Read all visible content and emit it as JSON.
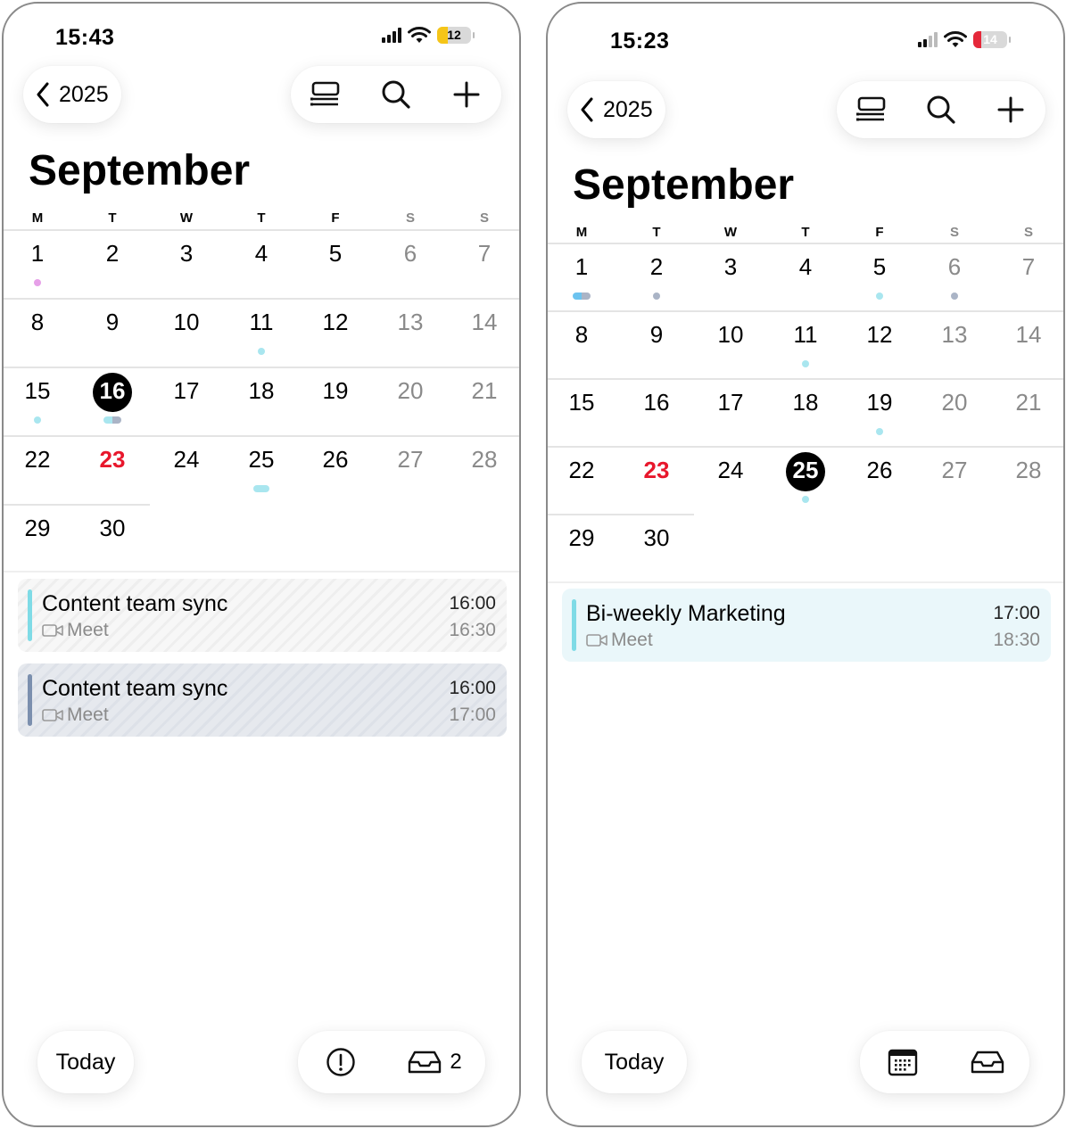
{
  "left": {
    "status": {
      "time": "15:43",
      "battery": "12",
      "battery_color": "#f5c518"
    },
    "nav": {
      "back_label": "2025"
    },
    "month_title": "September",
    "weekdays": [
      "M",
      "T",
      "W",
      "T",
      "F",
      "S",
      "S"
    ],
    "weeks": [
      [
        "1",
        "2",
        "3",
        "4",
        "5",
        "6",
        "7"
      ],
      [
        "8",
        "9",
        "10",
        "11",
        "12",
        "13",
        "14"
      ],
      [
        "15",
        "16",
        "17",
        "18",
        "19",
        "20",
        "21"
      ],
      [
        "22",
        "23",
        "24",
        "25",
        "26",
        "27",
        "28"
      ],
      [
        "29",
        "30"
      ]
    ],
    "selected_day": "16",
    "holiday_day": "23",
    "events": [
      {
        "title": "Content team sync",
        "location": "Meet",
        "start": "16:00",
        "end": "16:30",
        "color": "#7fdbe6"
      },
      {
        "title": "Content team sync",
        "location": "Meet",
        "start": "16:00",
        "end": "17:00",
        "color": "#7b8fae"
      }
    ],
    "bottom": {
      "today_label": "Today",
      "inbox_count": "2"
    }
  },
  "right": {
    "status": {
      "time": "15:23",
      "battery": "14",
      "battery_color": "#e5283a"
    },
    "nav": {
      "back_label": "2025"
    },
    "month_title": "September",
    "weekdays": [
      "M",
      "T",
      "W",
      "T",
      "F",
      "S",
      "S"
    ],
    "weeks": [
      [
        "1",
        "2",
        "3",
        "4",
        "5",
        "6",
        "7"
      ],
      [
        "8",
        "9",
        "10",
        "11",
        "12",
        "13",
        "14"
      ],
      [
        "15",
        "16",
        "17",
        "18",
        "19",
        "20",
        "21"
      ],
      [
        "22",
        "23",
        "24",
        "25",
        "26",
        "27",
        "28"
      ],
      [
        "29",
        "30"
      ]
    ],
    "selected_day": "25",
    "holiday_day": "23",
    "events": [
      {
        "title": "Bi-weekly Marketing",
        "location": "Meet",
        "start": "17:00",
        "end": "18:30",
        "color": "#7fdbe6"
      }
    ],
    "bottom": {
      "today_label": "Today"
    }
  },
  "icons": {
    "back": "chevron-left-icon",
    "list_view": "list-view-icon",
    "search": "search-icon",
    "add": "plus-icon",
    "alert": "alert-circle-icon",
    "inbox": "inbox-icon",
    "calendar": "calendar-grid-icon",
    "meet": "video-camera-icon"
  },
  "colors": {
    "holiday": "#e8172c",
    "dot_cyan": "#a9e6ef",
    "dot_slate": "#aab4c6",
    "dot_pink": "#e6a0e8",
    "dot_blue": "#6cc3ef"
  }
}
